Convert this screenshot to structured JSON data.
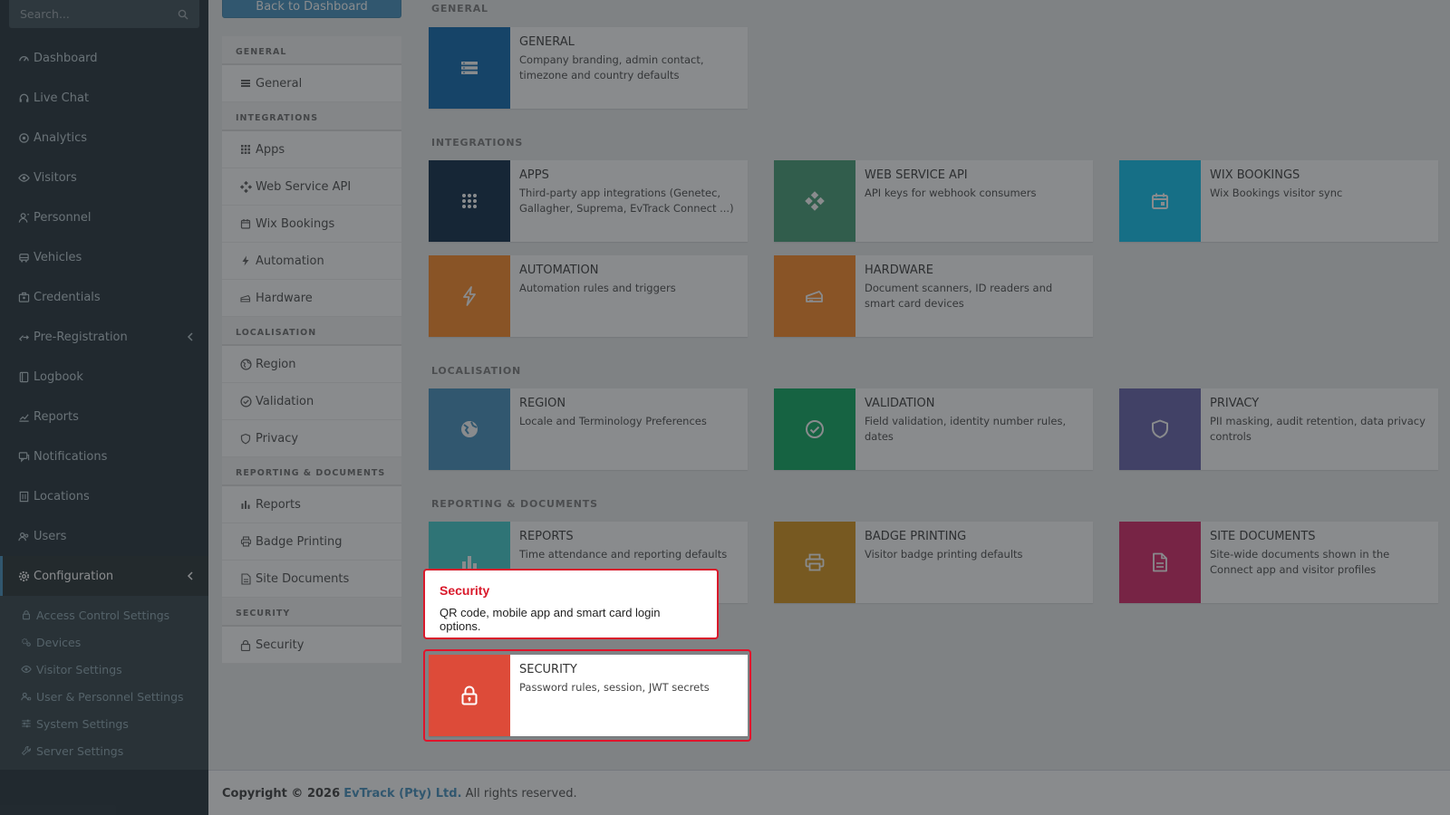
{
  "sidebar": {
    "search_placeholder": "Search...",
    "items": [
      {
        "label": "Dashboard",
        "icon": "dashboard-icon"
      },
      {
        "label": "Live Chat",
        "icon": "headset-icon"
      },
      {
        "label": "Analytics",
        "icon": "target-icon"
      },
      {
        "label": "Visitors",
        "icon": "eye-icon"
      },
      {
        "label": "Personnel",
        "icon": "user-tie-icon"
      },
      {
        "label": "Vehicles",
        "icon": "bus-icon"
      },
      {
        "label": "Credentials",
        "icon": "id-card-icon"
      },
      {
        "label": "Pre-Registration",
        "icon": "arrows-icon"
      },
      {
        "label": "Logbook",
        "icon": "book-icon"
      },
      {
        "label": "Reports",
        "icon": "chart-icon"
      },
      {
        "label": "Notifications",
        "icon": "chat-icon"
      },
      {
        "label": "Locations",
        "icon": "building-icon"
      },
      {
        "label": "Users",
        "icon": "users-icon"
      },
      {
        "label": "Configuration",
        "icon": "gear-icon"
      }
    ],
    "subitems": [
      {
        "label": "Access Control Settings"
      },
      {
        "label": "Devices"
      },
      {
        "label": "Visitor Settings"
      },
      {
        "label": "User & Personnel Settings"
      },
      {
        "label": "System Settings"
      },
      {
        "label": "Server Settings"
      }
    ]
  },
  "back_button": "Back to Dashboard",
  "menu": {
    "general_head": "GENERAL",
    "general_items": [
      "General"
    ],
    "integrations_head": "INTEGRATIONS",
    "integrations_items": [
      "Apps",
      "Web Service API",
      "Wix Bookings",
      "Automation",
      "Hardware"
    ],
    "localisation_head": "LOCALISATION",
    "localisation_items": [
      "Region",
      "Validation",
      "Privacy"
    ],
    "reporting_head": "REPORTING & DOCUMENTS",
    "reporting_items": [
      "Reports",
      "Badge Printing",
      "Site Documents"
    ],
    "security_head": "SECURITY",
    "security_items": [
      "Security"
    ]
  },
  "sections": {
    "general": "GENERAL",
    "integrations": "INTEGRATIONS",
    "localisation": "LOCALISATION",
    "reporting": "REPORTING & DOCUMENTS"
  },
  "tiles": {
    "general": {
      "title": "GENERAL",
      "desc": "Company branding, admin contact, timezone and country defaults",
      "color": "#0063ae"
    },
    "apps": {
      "title": "APPS",
      "desc": "Third-party app integrations (Genetec, Gallagher, Suprema, EvTrack Connect ...)",
      "color": "#001f3f"
    },
    "webapi": {
      "title": "WEB SERVICE API",
      "desc": "API keys for webhook consumers",
      "color": "#3d9970"
    },
    "wix": {
      "title": "WIX BOOKINGS",
      "desc": "Wix Bookings visitor sync",
      "color": "#00c0ef"
    },
    "automation": {
      "title": "AUTOMATION",
      "desc": "Automation rules and triggers",
      "color": "#ff851b"
    },
    "hardware": {
      "title": "HARDWARE",
      "desc": "Document scanners, ID readers and smart card devices",
      "color": "#ff851b"
    },
    "region": {
      "title": "REGION",
      "desc": "Locale and Terminology Preferences",
      "color": "#3c8dbc"
    },
    "validation": {
      "title": "VALIDATION",
      "desc": "Field validation, identity number rules, dates",
      "color": "#00a65a"
    },
    "privacy": {
      "title": "PRIVACY",
      "desc": "PII masking, audit retention, data privacy controls",
      "color": "#605ca8"
    },
    "reports": {
      "title": "REPORTS",
      "desc": "Time attendance and reporting defaults",
      "color": "#39cccc"
    },
    "badge": {
      "title": "BADGE PRINTING",
      "desc": "Visitor badge printing defaults",
      "color": "#d89010"
    },
    "sitedocs": {
      "title": "SITE DOCUMENTS",
      "desc": "Site-wide documents shown in the Connect app and visitor profiles",
      "color": "#d81b60"
    },
    "security": {
      "title": "SECURITY",
      "desc": "Password rules, session, JWT secrets",
      "color": "#dd4b39"
    }
  },
  "tooltip": {
    "title": "Security",
    "desc": "QR code, mobile app and smart card login options."
  },
  "footer": {
    "prefix": "Copyright © 2026",
    "brand": "EvTrack (Pty) Ltd.",
    "suffix": "All rights reserved."
  }
}
